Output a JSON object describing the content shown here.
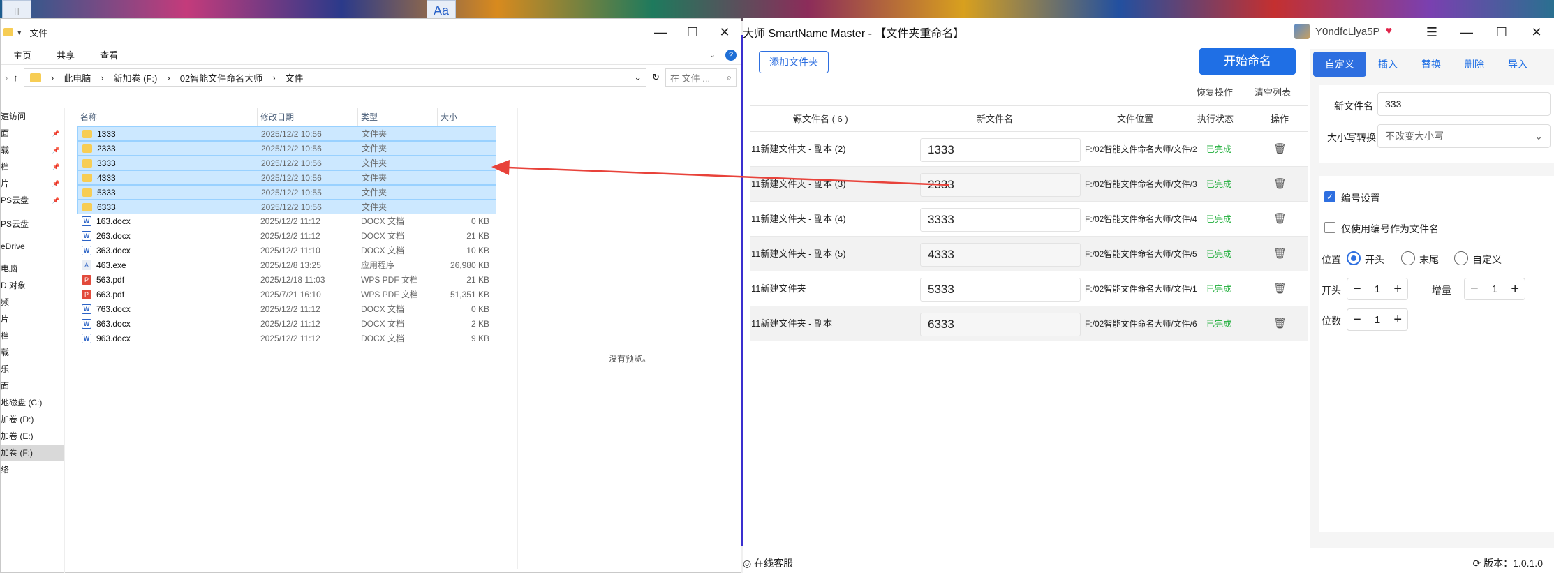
{
  "desktop": {
    "icon_glyph": "Aa"
  },
  "explorer": {
    "window_title": "文件",
    "ribbon_tabs": [
      "主页",
      "共享",
      "查看"
    ],
    "address_parts": [
      "此电脑",
      "新加卷 (F:)",
      "02智能文件命名大师",
      "文件"
    ],
    "search_placeholder": "在 文件 ...",
    "nav_items": [
      "速访问",
      "面",
      "载",
      "档",
      "片",
      "PS云盘",
      "PS云盘",
      "eDrive",
      "电脑",
      "D 对象",
      "频",
      "片",
      "档",
      "载",
      "乐",
      "面",
      "地磁盘 (C:)",
      "加卷 (D:)",
      "加卷 (E:)",
      "加卷 (F:)",
      "络"
    ],
    "columns": [
      "名称",
      "修改日期",
      "类型",
      "大小"
    ],
    "files": [
      {
        "name": "1333",
        "date": "2025/12/2 10:56",
        "type": "文件夹",
        "size": "",
        "icon": "folder",
        "selected": true
      },
      {
        "name": "2333",
        "date": "2025/12/2 10:56",
        "type": "文件夹",
        "size": "",
        "icon": "folder",
        "selected": true
      },
      {
        "name": "3333",
        "date": "2025/12/2 10:56",
        "type": "文件夹",
        "size": "",
        "icon": "folder",
        "selected": true
      },
      {
        "name": "4333",
        "date": "2025/12/2 10:56",
        "type": "文件夹",
        "size": "",
        "icon": "folder",
        "selected": true
      },
      {
        "name": "5333",
        "date": "2025/12/2 10:55",
        "type": "文件夹",
        "size": "",
        "icon": "folder",
        "selected": true
      },
      {
        "name": "6333",
        "date": "2025/12/2 10:56",
        "type": "文件夹",
        "size": "",
        "icon": "folder",
        "selected": true
      },
      {
        "name": "163.docx",
        "date": "2025/12/2 11:12",
        "type": "DOCX 文档",
        "size": "0 KB",
        "icon": "docx",
        "selected": false
      },
      {
        "name": "263.docx",
        "date": "2025/12/2 11:12",
        "type": "DOCX 文档",
        "size": "21 KB",
        "icon": "docx",
        "selected": false
      },
      {
        "name": "363.docx",
        "date": "2025/12/2 11:10",
        "type": "DOCX 文档",
        "size": "10 KB",
        "icon": "docx",
        "selected": false
      },
      {
        "name": "463.exe",
        "date": "2025/12/8 13:25",
        "type": "应用程序",
        "size": "26,980 KB",
        "icon": "exe",
        "selected": false
      },
      {
        "name": "563.pdf",
        "date": "2025/12/18 11:03",
        "type": "WPS PDF 文档",
        "size": "21 KB",
        "icon": "pdf",
        "selected": false
      },
      {
        "name": "663.pdf",
        "date": "2025/7/21 16:10",
        "type": "WPS PDF 文档",
        "size": "51,351 KB",
        "icon": "pdf",
        "selected": false
      },
      {
        "name": "763.docx",
        "date": "2025/12/2 11:12",
        "type": "DOCX 文档",
        "size": "0 KB",
        "icon": "docx",
        "selected": false
      },
      {
        "name": "863.docx",
        "date": "2025/12/2 11:12",
        "type": "DOCX 文档",
        "size": "2 KB",
        "icon": "docx",
        "selected": false
      },
      {
        "name": "963.docx",
        "date": "2025/12/2 11:12",
        "type": "DOCX 文档",
        "size": "9 KB",
        "icon": "docx",
        "selected": false
      }
    ],
    "preview_text": "没有预览。"
  },
  "app": {
    "title": "大师 SmartName Master - 【文件夹重命名】",
    "username": "Y0ndfcLlya5P",
    "add_folder": "添加文件夹",
    "start_rename": "开始命名",
    "restore": "恢复操作",
    "clear_list": "清空列表",
    "headers": {
      "source": "源文件名 ( 6 )",
      "new": "新文件名",
      "location": "文件位置",
      "status": "执行状态",
      "action": "操作"
    },
    "rows": [
      {
        "source": "11新建文件夹 - 副本 (2)",
        "new": "1333",
        "location": "F:/02智能文件命名大师/文件/2",
        "status": "已完成"
      },
      {
        "source": "11新建文件夹 - 副本 (3)",
        "new": "2333",
        "location": "F:/02智能文件命名大师/文件/3",
        "status": "已完成"
      },
      {
        "source": "11新建文件夹 - 副本 (4)",
        "new": "3333",
        "location": "F:/02智能文件命名大师/文件/4",
        "status": "已完成"
      },
      {
        "source": "11新建文件夹 - 副本 (5)",
        "new": "4333",
        "location": "F:/02智能文件命名大师/文件/5",
        "status": "已完成"
      },
      {
        "source": "11新建文件夹",
        "new": "5333",
        "location": "F:/02智能文件命名大师/文件/1",
        "status": "已完成"
      },
      {
        "source": "11新建文件夹 - 副本",
        "new": "6333",
        "location": "F:/02智能文件命名大师/文件/6",
        "status": "已完成"
      }
    ],
    "tabs": [
      "自定义",
      "插入",
      "替换",
      "删除",
      "导入"
    ],
    "new_name_label": "新文件名",
    "new_name_value": "333",
    "case_label": "大小写转换",
    "case_value": "不改变大小写",
    "numbering_label": "编号设置",
    "numbering_checked": true,
    "only_number_label": "仅使用编号作为文件名",
    "only_number_checked": false,
    "position_label": "位置",
    "position_options": [
      "开头",
      "末尾",
      "自定义"
    ],
    "start_label": "开头",
    "start_value": "1",
    "increment_label": "增量",
    "increment_value": "1",
    "digits_label": "位数",
    "digits_value": "1",
    "online_service": "在线客服",
    "version": "版本：1.0.1.0"
  },
  "colors": {
    "accent": "#2e6fe0",
    "done": "#1fae3a",
    "arrow": "#e8423a",
    "side_bar": "#3a2fcf"
  }
}
